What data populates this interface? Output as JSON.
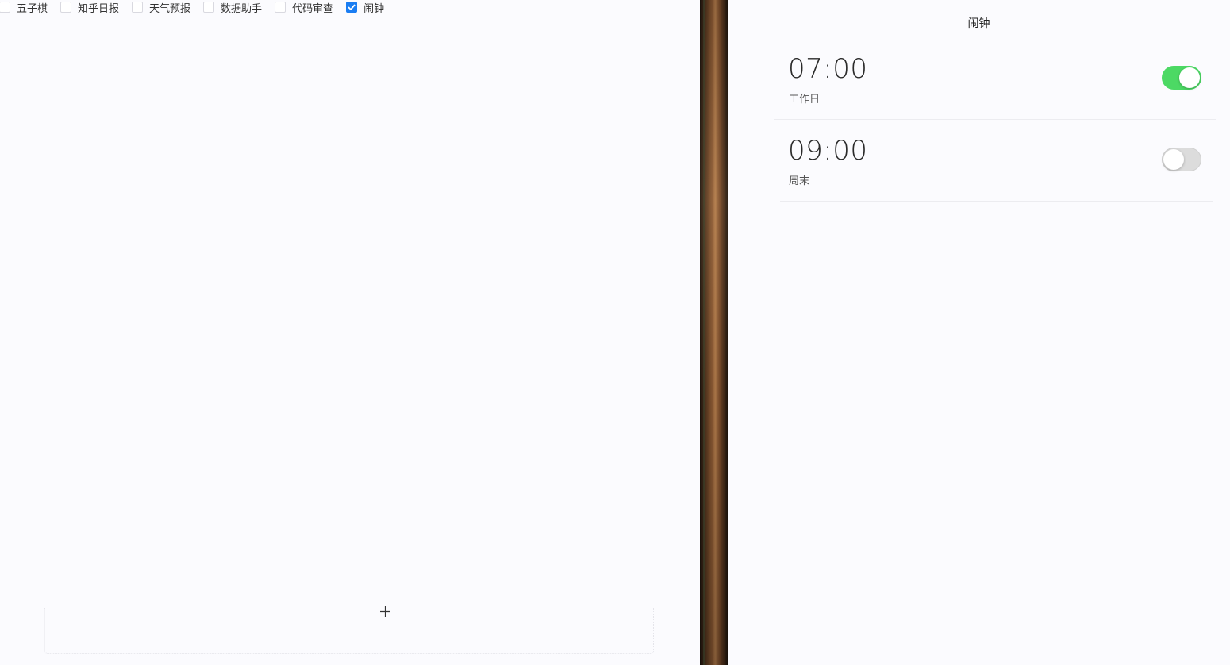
{
  "tabs": [
    {
      "label": "五子棋",
      "checked": false
    },
    {
      "label": "知乎日报",
      "checked": false
    },
    {
      "label": "天气预报",
      "checked": false
    },
    {
      "label": "数据助手",
      "checked": false
    },
    {
      "label": "代码审查",
      "checked": false
    },
    {
      "label": "闹钟",
      "checked": true
    }
  ],
  "add_button": {
    "icon": "plus-icon"
  },
  "alarm_panel": {
    "title": "闹钟",
    "alarms": [
      {
        "time": "07:00",
        "label": "工作日",
        "enabled": true
      },
      {
        "time": "09:00",
        "label": "周末",
        "enabled": false
      }
    ]
  },
  "colors": {
    "checkbox_checked": "#1a7df2",
    "toggle_on": "#4cd964",
    "toggle_off": "#dcdcdc",
    "background": "#fbfbfe"
  }
}
